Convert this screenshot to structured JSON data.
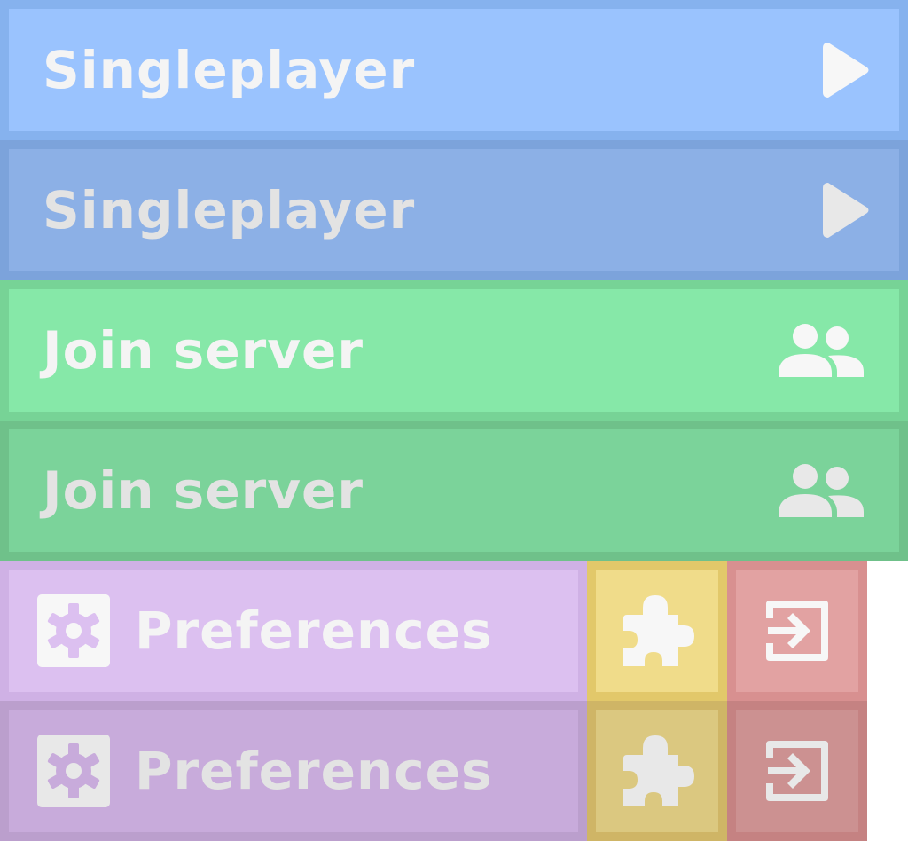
{
  "menu": {
    "singleplayer": {
      "label": "Singleplayer",
      "icon": "play-icon"
    },
    "join_server": {
      "label": "Join server",
      "icon": "people-icon"
    },
    "preferences": {
      "label": "Preferences",
      "icon": "gear-icon"
    },
    "mods": {
      "icon": "puzzle-icon"
    },
    "exit": {
      "icon": "exit-icon"
    }
  },
  "states": [
    "normal",
    "hover"
  ],
  "colors": {
    "blue": "#9ac3fe",
    "blue_hover": "#8cb0e6",
    "green": "#86e8a8",
    "green_hover": "#7bd39a",
    "purple": "#dcc0f0",
    "purple_hover": "#c8abdb",
    "yellow": "#f0dc8a",
    "yellow_hover": "#dbc880",
    "red": "#e2a2a2",
    "red_hover": "#cc9191"
  }
}
